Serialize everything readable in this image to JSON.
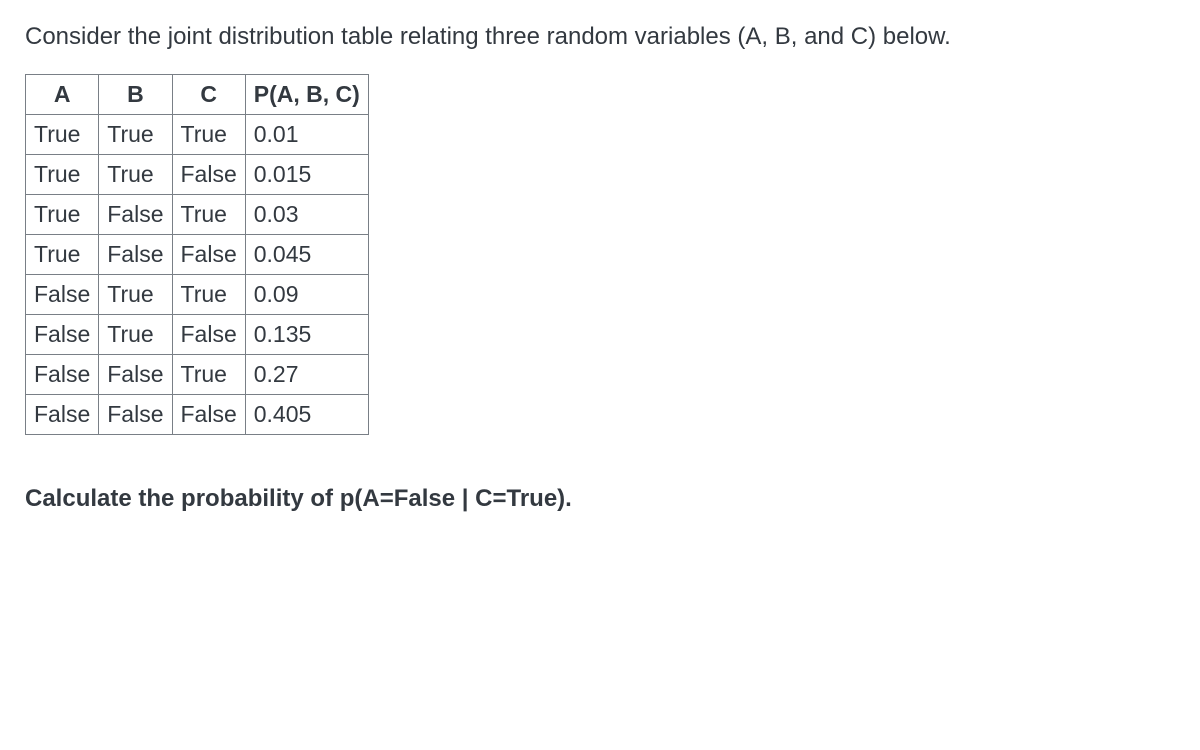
{
  "intro": "Consider the joint distribution table relating three random variables (A, B, and C) below.",
  "headers": {
    "A": "A",
    "B": "B",
    "C": "C",
    "P": "P(A, B, C)"
  },
  "rows": [
    {
      "A": "True",
      "B": "True",
      "C": "True",
      "P": "0.01"
    },
    {
      "A": "True",
      "B": "True",
      "C": "False",
      "P": "0.015"
    },
    {
      "A": "True",
      "B": "False",
      "C": "True",
      "P": "0.03"
    },
    {
      "A": "True",
      "B": "False",
      "C": "False",
      "P": "0.045"
    },
    {
      "A": "False",
      "B": "True",
      "C": "True",
      "P": "0.09"
    },
    {
      "A": "False",
      "B": "True",
      "C": "False",
      "P": "0.135"
    },
    {
      "A": "False",
      "B": "False",
      "C": "True",
      "P": "0.27"
    },
    {
      "A": "False",
      "B": "False",
      "C": "False",
      "P": "0.405"
    }
  ],
  "question": "Calculate the probability of p(A=False | C=True)."
}
